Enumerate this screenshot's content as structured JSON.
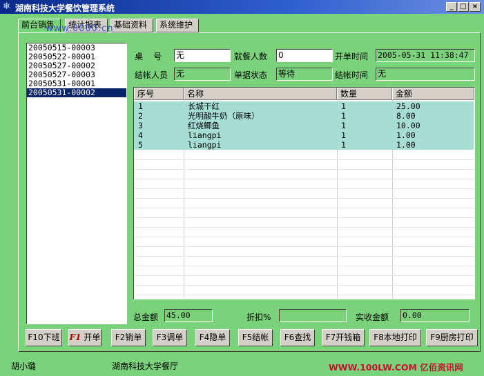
{
  "window": {
    "title": "湖南科技大学餐饮管理系统",
    "controls": [
      "_",
      "□",
      "×"
    ]
  },
  "tabs": [
    {
      "label": "前台销售"
    },
    {
      "label": "统计报表"
    },
    {
      "label": "基础资料"
    },
    {
      "label": "系统维护"
    }
  ],
  "watermark": "www.0000.cn",
  "order_list": [
    "20050515-00003",
    "20050522-00001",
    "20050527-00002",
    "20050527-00003",
    "20050531-00001",
    "20050531-00002"
  ],
  "selected_order_index": 5,
  "form": {
    "table_label": "桌    号",
    "table_value": "无",
    "diners_label": "就餐人数",
    "diners_value": "0",
    "open_time_label": "开单时间",
    "open_time_value": "2005-05-31 11:38:47",
    "cashier_label": "结帐人员",
    "cashier_value": "无",
    "status_label": "单据状态",
    "status_value": "等待",
    "checkout_time_label": "结帐时间",
    "checkout_time_value": "无"
  },
  "grid": {
    "columns": [
      "序号",
      "名称",
      "数量",
      "金额"
    ],
    "rows": [
      {
        "no": "1",
        "name": "长城干红",
        "qty": "1",
        "amount": "25.00"
      },
      {
        "no": "2",
        "name": "光明酸牛奶（原味）",
        "qty": "1",
        "amount": "8.00"
      },
      {
        "no": "3",
        "name": "红烧鲫鱼",
        "qty": "1",
        "amount": "10.00"
      },
      {
        "no": "4",
        "name": "liangpi",
        "qty": "1",
        "amount": "1.00"
      },
      {
        "no": "5",
        "name": "liangpi",
        "qty": "1",
        "amount": "1.00"
      }
    ]
  },
  "totals": {
    "total_label": "总金额",
    "total_value": "45.00",
    "discount_label": "折扣%",
    "discount_value": "",
    "received_label": "实收金额",
    "received_value": "0.00"
  },
  "function_keys": [
    {
      "label": "F10下班"
    },
    {
      "label": "开单",
      "prefix": "F1"
    },
    {
      "label": "F2销单"
    },
    {
      "label": "F3调单"
    },
    {
      "label": "F4隐单"
    },
    {
      "label": "F5结帐"
    },
    {
      "label": "F6查找"
    },
    {
      "label": "F7开钱箱"
    },
    {
      "label": "F8本地打印"
    },
    {
      "label": "F9厨房打印"
    }
  ],
  "statusbar": {
    "user": "胡小璐",
    "location": "湖南科技大学餐厅",
    "site": "WWW.100LW.COM 亿佰资讯网"
  },
  "colors": {
    "background": "#7ad37a",
    "selection": "#0a246a",
    "row_highlight": "#a6ded4",
    "site_text": "#c8102e"
  }
}
